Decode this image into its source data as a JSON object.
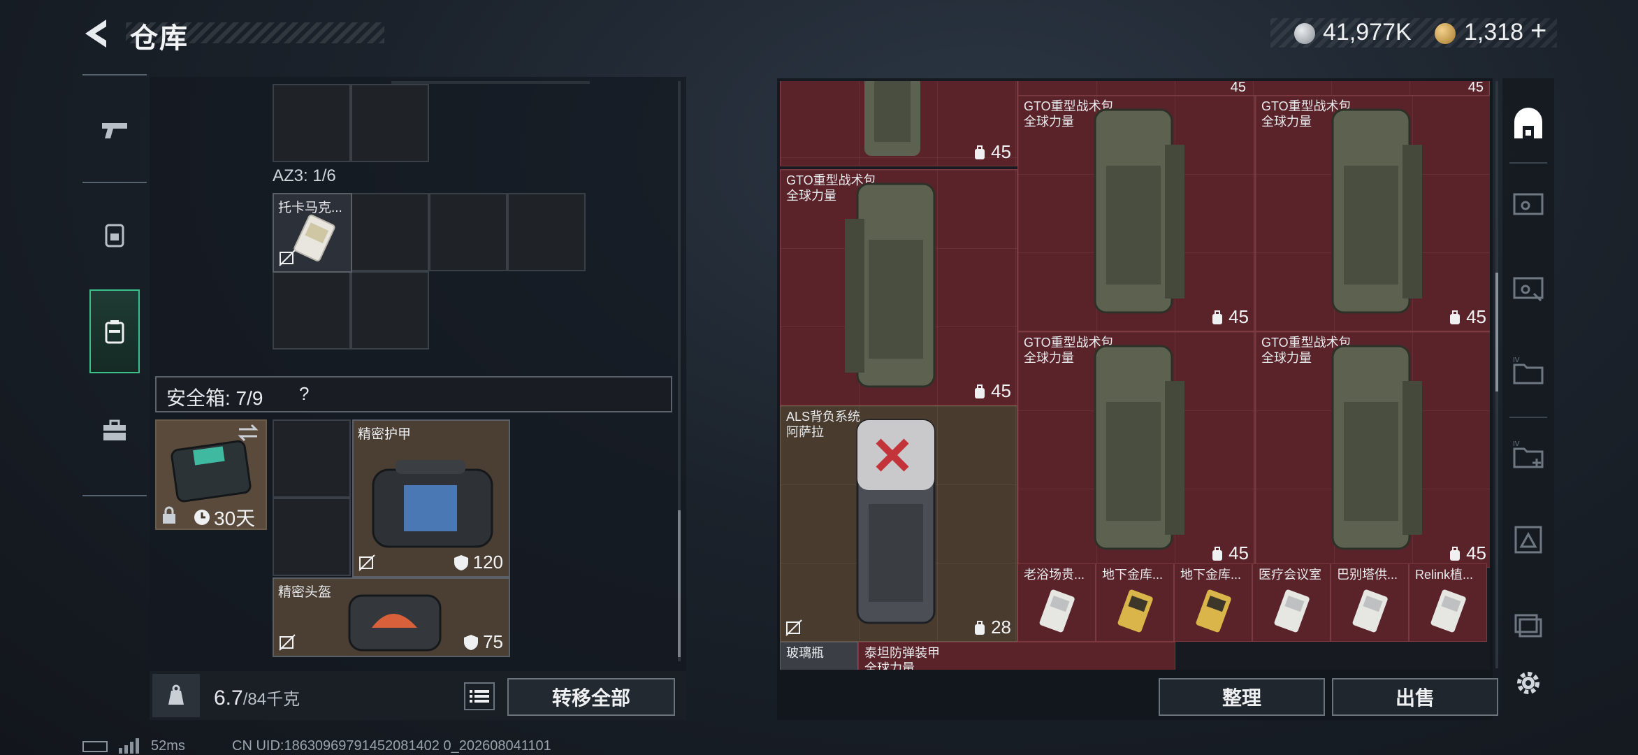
{
  "header": {
    "title": "仓库",
    "currency": {
      "silver_amount": "41,977K",
      "gold_amount": "1,318",
      "add_label": "+"
    }
  },
  "left_nav": {
    "items": [
      {
        "icon": "pistol-icon",
        "active": false
      },
      {
        "icon": "backpack-icon",
        "active": false
      },
      {
        "icon": "container-icon",
        "active": true
      },
      {
        "icon": "toolbox-icon",
        "active": false
      }
    ]
  },
  "inventory": {
    "az3_label": "AZ3: 1/6",
    "az3_item": {
      "name": "托卡马克..."
    },
    "safe_box": {
      "label": "安全箱:  7/9",
      "help": "?",
      "timer": "30天"
    },
    "armor_item": {
      "name": "精密护甲",
      "value": "120"
    },
    "helmet_item": {
      "name": "精密头盔",
      "value": "75"
    },
    "weight": {
      "current": "6.7",
      "max": "/84千克"
    },
    "transfer_all_label": "转移全部"
  },
  "stash": {
    "items": [
      {
        "name": "",
        "sub": "",
        "count": "45"
      },
      {
        "name": "GTO重型战术包",
        "sub": "全球力量",
        "count": "45"
      },
      {
        "name": "GTO重型战术包",
        "sub": "全球力量",
        "count": "45"
      },
      {
        "name": "GTO重型战术包",
        "sub": "全球力量",
        "count": "45"
      },
      {
        "name": "GTO重型战术包",
        "sub": "全球力量",
        "count": "45"
      },
      {
        "name": "GTO重型战术包",
        "sub": "全球力量",
        "count": "45"
      },
      {
        "name": "ALS背负系统",
        "sub": "阿萨拉",
        "count": "28"
      }
    ],
    "top_counts": [
      "45",
      "45"
    ],
    "small_items": [
      {
        "name": "老浴场贵..."
      },
      {
        "name": "地下金库..."
      },
      {
        "name": "地下金库..."
      },
      {
        "name": "医疗会议室"
      },
      {
        "name": "巴别塔供..."
      },
      {
        "name": "Relink植..."
      }
    ],
    "partial_items": [
      {
        "name": "玻璃瓶"
      },
      {
        "name": "泰坦防弹装甲",
        "sub": "全球力量"
      }
    ],
    "organize_label": "整理",
    "sell_label": "出售"
  },
  "right_nav": {
    "items": [
      {
        "icon": "stash-home-icon",
        "active": true
      },
      {
        "icon": "key-card-icon",
        "active": false
      },
      {
        "icon": "key-card-search-icon",
        "active": false
      },
      {
        "icon": "folder-iv-icon",
        "active": false
      },
      {
        "icon": "medical-iv-icon",
        "active": false
      },
      {
        "icon": "tri-card-icon",
        "active": false
      },
      {
        "icon": "misc-stack-icon",
        "active": false
      }
    ]
  },
  "status": {
    "ping": "52ms",
    "uid": "CN UID:18630969791452081402 0_202608041101"
  },
  "colors": {
    "accent_green": "#3bbf8b",
    "stash_red": "#5a2329",
    "item_brown": "#4b3e33"
  }
}
